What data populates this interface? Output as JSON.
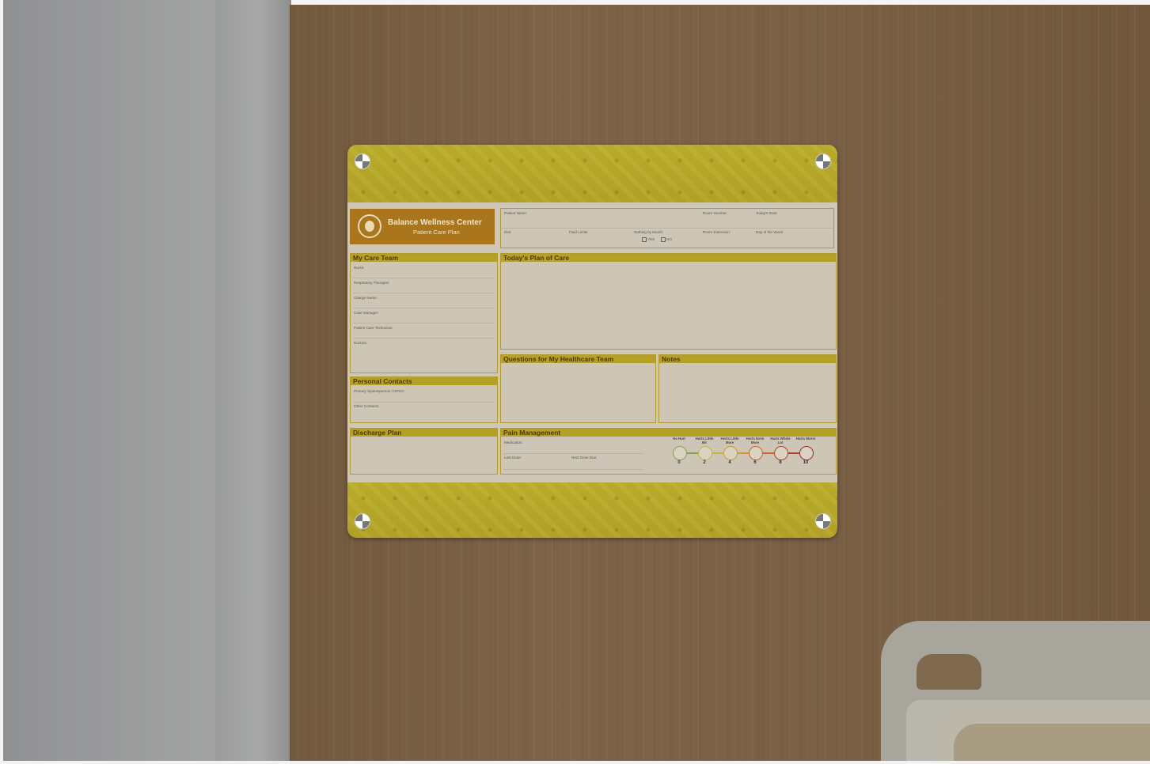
{
  "logo": {
    "title": "Balance Wellness Center",
    "subtitle": "Patient Care Plan"
  },
  "top_fields": {
    "patient_name": "Patient Name:",
    "room_number": "Room Number:",
    "todays_date": "Today's Date:",
    "diet": "Diet:",
    "fluid_limits": "Fluid Limits:",
    "nothing_by_mouth": "Nothing by Mouth:",
    "yes": "YES",
    "no": "NO",
    "room_extension": "Room Extension:",
    "day_of_week": "Day of the Week:"
  },
  "care_team": {
    "title": "My Care Team",
    "fields": [
      "Nurse:",
      "Respiratory Therapist:",
      "Charge Nurse:",
      "Case Manager:",
      "Patient Care Technician:",
      "Doctors:"
    ]
  },
  "personal_contacts": {
    "title": "Personal Contacts",
    "fields": [
      "Primary Spokesperson / DPOA:",
      "Other Contacts:"
    ]
  },
  "discharge_plan": {
    "title": "Discharge Plan"
  },
  "plan_of_care": {
    "title": "Today's Plan of Care"
  },
  "questions": {
    "title": "Questions for My Healthcare Team"
  },
  "notes": {
    "title": "Notes"
  },
  "pain_management": {
    "title": "Pain Management",
    "medication": "Medication:",
    "last_dose": "Last Dose:",
    "next_dose": "Next Dose Due:",
    "scale": [
      {
        "label": "No Hurt",
        "value": "0",
        "color": "#8aa04a"
      },
      {
        "label": "Hurts Little Bit",
        "value": "2",
        "color": "#c8b43a"
      },
      {
        "label": "Hurts Little More",
        "value": "4",
        "color": "#d49a30"
      },
      {
        "label": "Hurts Even More",
        "value": "6",
        "color": "#c9672a"
      },
      {
        "label": "Hurts Whole Lot",
        "value": "8",
        "color": "#b8412a"
      },
      {
        "label": "Hurts Worst",
        "value": "10",
        "color": "#a02a2a"
      }
    ]
  }
}
